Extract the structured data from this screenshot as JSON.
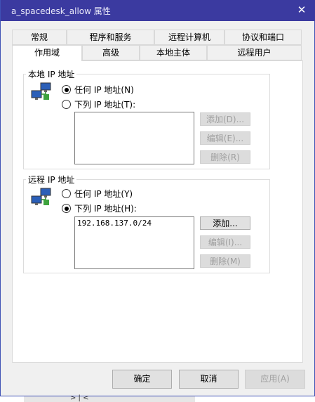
{
  "window": {
    "title": "a_spacedesk_allow 属性",
    "close_glyph": "✕"
  },
  "tabs_row1": [
    {
      "label": "常规"
    },
    {
      "label": "程序和服务"
    },
    {
      "label": "远程计算机"
    },
    {
      "label": "协议和端口"
    }
  ],
  "tabs_row2": [
    {
      "label": "作用域",
      "active": true
    },
    {
      "label": "高级"
    },
    {
      "label": "本地主体"
    },
    {
      "label": "远程用户"
    }
  ],
  "local_ip": {
    "group_label": "本地 IP 地址",
    "option_any": "任何 IP 地址(N)",
    "option_list": "下列 IP 地址(T):",
    "selected": "any",
    "entries": [],
    "add_label": "添加(D)...",
    "edit_label": "编辑(E)...",
    "remove_label": "删除(R)"
  },
  "remote_ip": {
    "group_label": "远程 IP 地址",
    "option_any": "任何 IP 地址(Y)",
    "option_list": "下列 IP 地址(H):",
    "selected": "list",
    "entries": [
      "192.168.137.0/24"
    ],
    "add_label": "添加...",
    "edit_label": "编辑(I)...",
    "remove_label": "删除(M)"
  },
  "footer": {
    "ok_label": "确定",
    "cancel_label": "取消",
    "apply_label": "应用(A)"
  },
  "taskbar": {
    "glyphs": "> | <"
  }
}
